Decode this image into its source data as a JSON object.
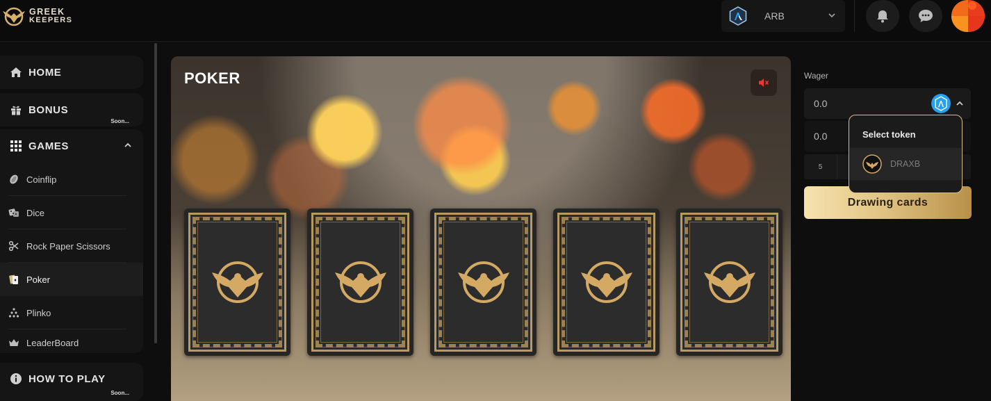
{
  "brand": {
    "line1": "GREEK",
    "line2": "KEEPERS"
  },
  "header": {
    "network": {
      "label": "ARB",
      "icon": "arbitrum-icon"
    },
    "notifications_icon": "bell-icon",
    "chat_icon": "chat-bubble-icon"
  },
  "sidebar": {
    "home": {
      "label": "HOME",
      "icon": "home-icon"
    },
    "bonus": {
      "label": "BONUS",
      "badge": "Soon...",
      "icon": "gift-icon"
    },
    "games": {
      "label": "GAMES",
      "icon": "grid-icon",
      "items": [
        {
          "label": "Coinflip",
          "icon": "coin-icon"
        },
        {
          "label": "Dice",
          "icon": "dice-icon"
        },
        {
          "label": "Rock Paper Scissors",
          "icon": "scissors-icon"
        },
        {
          "label": "Poker",
          "icon": "cards-icon",
          "active": true
        },
        {
          "label": "Plinko",
          "icon": "pyramid-icon"
        },
        {
          "label": "LeaderBoard",
          "icon": "crown-icon"
        }
      ]
    },
    "how_to_play": {
      "label": "HOW TO PLAY",
      "badge": "Soon...",
      "icon": "info-icon"
    }
  },
  "game": {
    "title": "POKER",
    "mute_icon": "speaker-muted-icon",
    "card_count": 5,
    "card_back_icon": "eagle-emblem-icon"
  },
  "wager": {
    "label": "Wager",
    "value": "0.0",
    "second_value": "0.0",
    "multiplier_value": "5",
    "action_label": "Drawing cards"
  },
  "token_popup": {
    "title": "Select token",
    "options": [
      {
        "name": "DRAXB",
        "icon": "draxb-coin-icon"
      }
    ]
  },
  "colors": {
    "gold": "#d9bf86",
    "gold_dark": "#b89048",
    "bg": "#0e0e0e",
    "mute_red": "#e53935",
    "arb_blue": "#28a0f0"
  }
}
